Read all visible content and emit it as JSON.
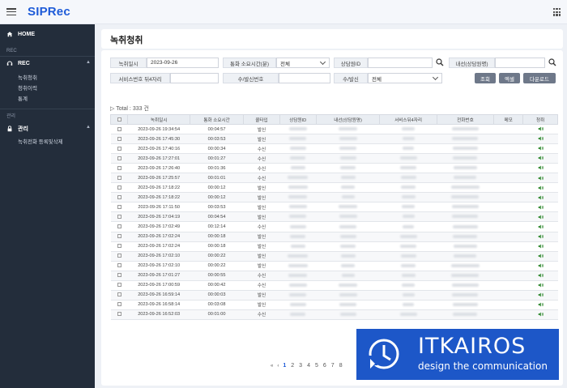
{
  "app": {
    "logo": "SIPRec"
  },
  "sidebar": {
    "home": "HOME",
    "section_rec": "REC",
    "group_rec": "REC",
    "rec_items": [
      "녹취청취",
      "청취이력",
      "통계"
    ],
    "section_admin": "관리",
    "group_admin": "관리",
    "admin_items": [
      "녹취전화 등록및삭제"
    ]
  },
  "page": {
    "title": "녹취청취"
  },
  "filters": {
    "record_date_label": "녹취일시",
    "record_date_value": "2023-09-26",
    "duration_label": "통화 소요시간(분)",
    "duration_value": "전체",
    "agent_id_label": "상담원ID",
    "agent_id_value": "",
    "extension_label": "내선(상담원명)",
    "extension_value": "",
    "service_label": "서비스번호 뒤4자리",
    "service_value": "",
    "caller_label": "수/발신번호",
    "caller_value": "",
    "direction_label": "수/발신",
    "direction_value": "전체",
    "btn_search": "조회",
    "btn_excel": "엑셀",
    "btn_download": "다운로드"
  },
  "table": {
    "total_text": "▷ Total : 333 건",
    "headers": [
      "",
      "녹취일시",
      "통화 소요시간",
      "콜타입",
      "상담원ID",
      "내선(상담원명)",
      "서비스뒤4자리",
      "전화번호",
      "메모",
      "청취"
    ],
    "rows": [
      [
        "2023-09-26 19:34:54",
        "00:04:57",
        "발신"
      ],
      [
        "2023-09-26 17:45:30",
        "00:03:53",
        "발신"
      ],
      [
        "2023-09-26 17:40:16",
        "00:00:34",
        "수신"
      ],
      [
        "2023-09-26 17:27:01",
        "00:01:27",
        "수신"
      ],
      [
        "2023-09-26 17:26:40",
        "00:01:36",
        "수신"
      ],
      [
        "2023-09-26 17:25:57",
        "00:01:01",
        "수신"
      ],
      [
        "2023-09-26 17:18:22",
        "00:00:12",
        "발신"
      ],
      [
        "2023-09-26 17:18:22",
        "00:00:12",
        "발신"
      ],
      [
        "2023-09-26 17:11:50",
        "00:03:53",
        "발신"
      ],
      [
        "2023-09-26 17:04:19",
        "00:04:54",
        "발신"
      ],
      [
        "2023-09-26 17:02:49",
        "00:12:14",
        "수신"
      ],
      [
        "2023-09-26 17:02:24",
        "00:00:18",
        "발신"
      ],
      [
        "2023-09-26 17:02:24",
        "00:00:18",
        "발신"
      ],
      [
        "2023-09-26 17:02:10",
        "00:00:22",
        "발신"
      ],
      [
        "2023-09-26 17:02:10",
        "00:00:22",
        "발신"
      ],
      [
        "2023-09-26 17:01:27",
        "00:00:55",
        "수신"
      ],
      [
        "2023-09-26 17:00:59",
        "00:00:42",
        "수신"
      ],
      [
        "2023-09-26 16:59:14",
        "00:00:03",
        "발신"
      ],
      [
        "2023-09-26 16:58:14",
        "00:03:08",
        "발신"
      ],
      [
        "2023-09-26 16:52:03",
        "00:01:00",
        "수신"
      ]
    ]
  },
  "pager": {
    "first": "«",
    "prev": "‹",
    "pages": [
      "1",
      "2",
      "3",
      "4",
      "5",
      "6",
      "7",
      "8"
    ]
  },
  "brand": {
    "name": "ITKAIROS",
    "tagline": "design the communication"
  },
  "colors": {
    "accent": "#1e5bd8",
    "sidebar_bg": "#232d3b",
    "brand_bg": "#1d57c8"
  }
}
